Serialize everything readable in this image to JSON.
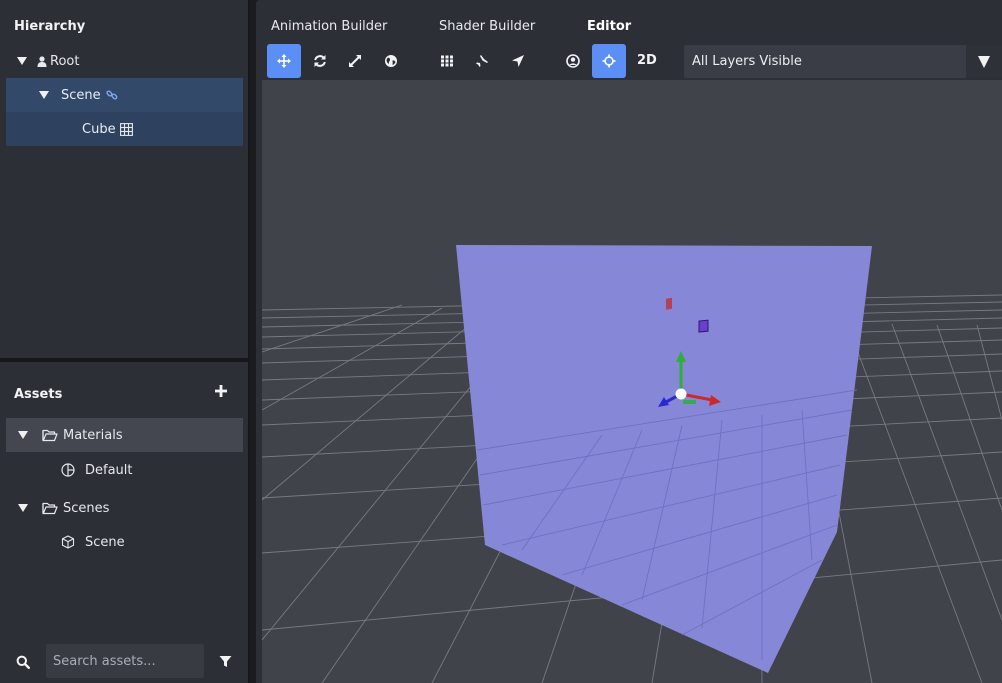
{
  "hierarchy": {
    "title": "Hierarchy",
    "items": [
      {
        "label": "Root",
        "icon": "user-icon"
      },
      {
        "label": "Scene",
        "icon": "link-icon"
      },
      {
        "label": "Cube",
        "icon": "grid-icon"
      }
    ]
  },
  "assets": {
    "title": "Assets",
    "items": [
      {
        "label": "Materials",
        "icon": "folder-open-icon"
      },
      {
        "label": "Default",
        "icon": "material-icon"
      },
      {
        "label": "Scenes",
        "icon": "folder-open-icon"
      },
      {
        "label": "Scene",
        "icon": "cube-outline-icon"
      }
    ],
    "search_placeholder": "Search assets..."
  },
  "tabs": [
    {
      "label": "Animation Builder"
    },
    {
      "label": "Shader Builder"
    },
    {
      "label": "Editor",
      "active": true
    }
  ],
  "toolbar": {
    "mode_2d": "2D",
    "layers_select": "All Layers Visible"
  },
  "colors": {
    "accent": "#5b8ff5",
    "cube_face": "#8787d8",
    "viewport_bg": "#404349",
    "panel_bg": "#2c2f36",
    "selected_row": "#33496a",
    "gizmo_x": "#cc2a2a",
    "gizmo_y": "#2fae3a",
    "gizmo_z": "#2a2acc"
  }
}
